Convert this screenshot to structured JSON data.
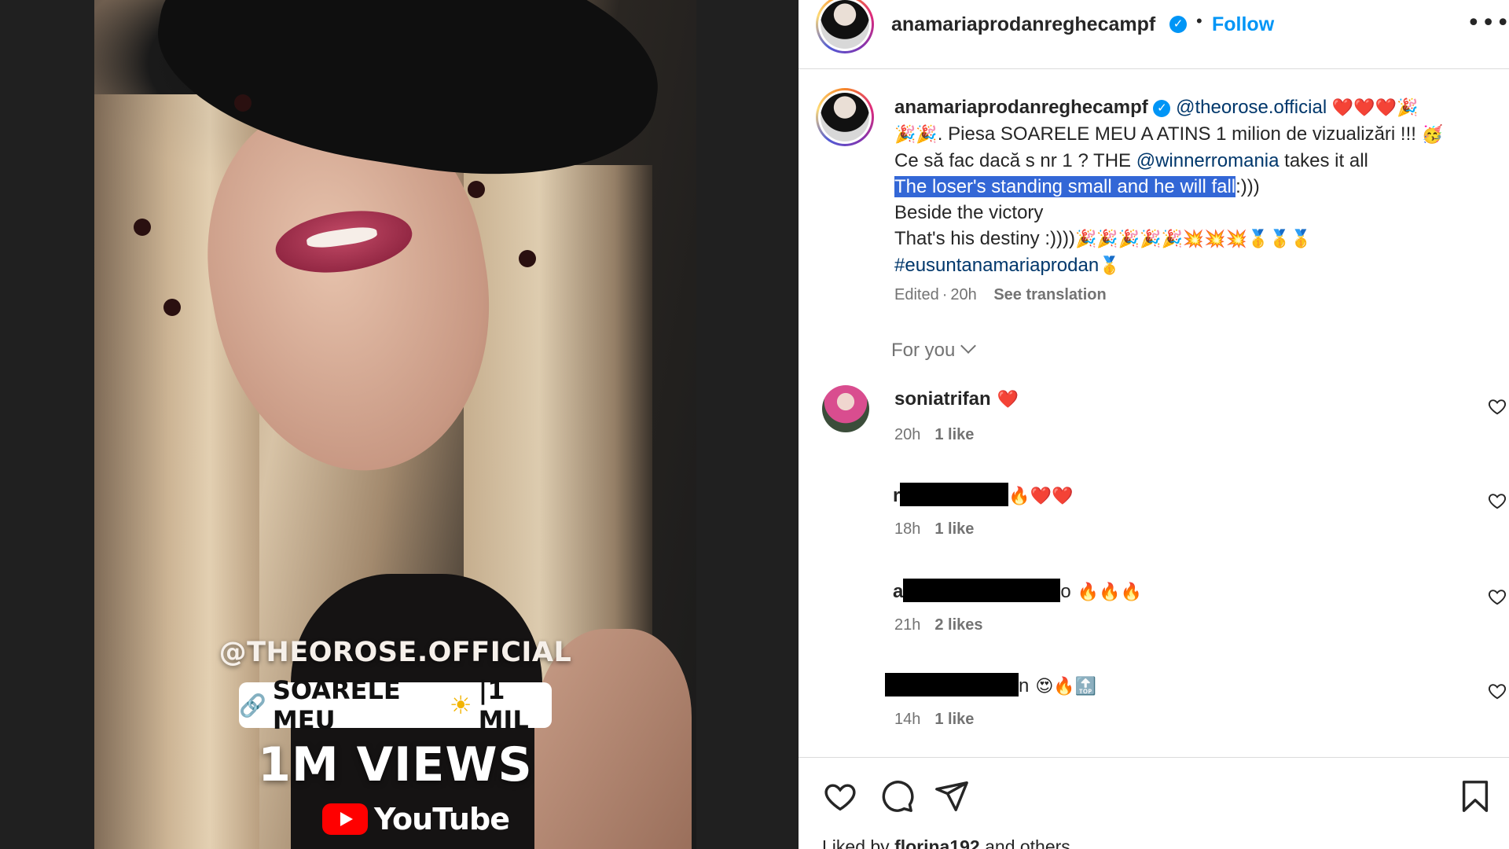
{
  "media": {
    "overlay_handle": "@THEOROSE.OFFICIAL",
    "overlay_pill_icon": "link-icon",
    "overlay_pill_text": "SOARELE MEU",
    "overlay_pill_emoji": "☀",
    "overlay_pill_count": "|1 MIL",
    "overlay_views": "1M VIEWS",
    "overlay_youtube": "YouTube"
  },
  "header": {
    "username": "anamariaprodanreghecampf",
    "dot": "•",
    "follow_label": "Follow",
    "more_label": "•••"
  },
  "caption": {
    "username": "anamariaprodanreghecampf",
    "mention1": "@theorose.official",
    "emoji_line1": "❤️❤️❤️🎉",
    "line2_emoji": "🎉🎉",
    "line2_text": ". Piesa SOARELE MEU A ATINS 1 milion de vizualizări !!! ",
    "line2_end_emoji": "🥳",
    "line3_pre": "Ce să fac dacă s nr 1 ? THE ",
    "mention2": "@winnerromania",
    "line3_post": " takes it all",
    "line4_highlight": "The loser's standing small and he will fall",
    "line4_tail": ":)))",
    "line5": "Beside the victory",
    "line6_text": "That's his destiny :))))",
    "line6_emoji": "🎉🎉🎉🎉🎉💥💥💥🥇🥇🥇",
    "hashtag": "#eusuntanamariaprodan",
    "hashtag_emoji": "🥇",
    "edited": "Edited",
    "time": "20h",
    "see_translation": "See translation"
  },
  "filter": {
    "label": "For you"
  },
  "comments": [
    {
      "user": "soniatrifan",
      "text": "❤️",
      "time": "20h",
      "likes": "1 like",
      "redacted": false
    },
    {
      "user": "r",
      "text": "🔥❤️❤️",
      "time": "18h",
      "likes": "1 like",
      "redacted": true
    },
    {
      "user": "a",
      "suffix": "o",
      "text": "🔥🔥🔥",
      "time": "21h",
      "likes": "2 likes",
      "redacted": true
    },
    {
      "user": "",
      "suffix": "n",
      "text": "😍🔥🔝",
      "time": "14h",
      "likes": "1 like",
      "redacted": true
    }
  ],
  "actions": {
    "like_icon": "heart-icon",
    "comment_icon": "comment-icon",
    "share_icon": "send-icon",
    "save_icon": "bookmark-icon"
  },
  "liked_by": {
    "prefix": "Liked by ",
    "user": "florina192",
    "suffix": " and others"
  },
  "colors": {
    "accent": "#0095f6",
    "selection": "#3367d6",
    "link": "#00376b",
    "muted": "#737373"
  }
}
